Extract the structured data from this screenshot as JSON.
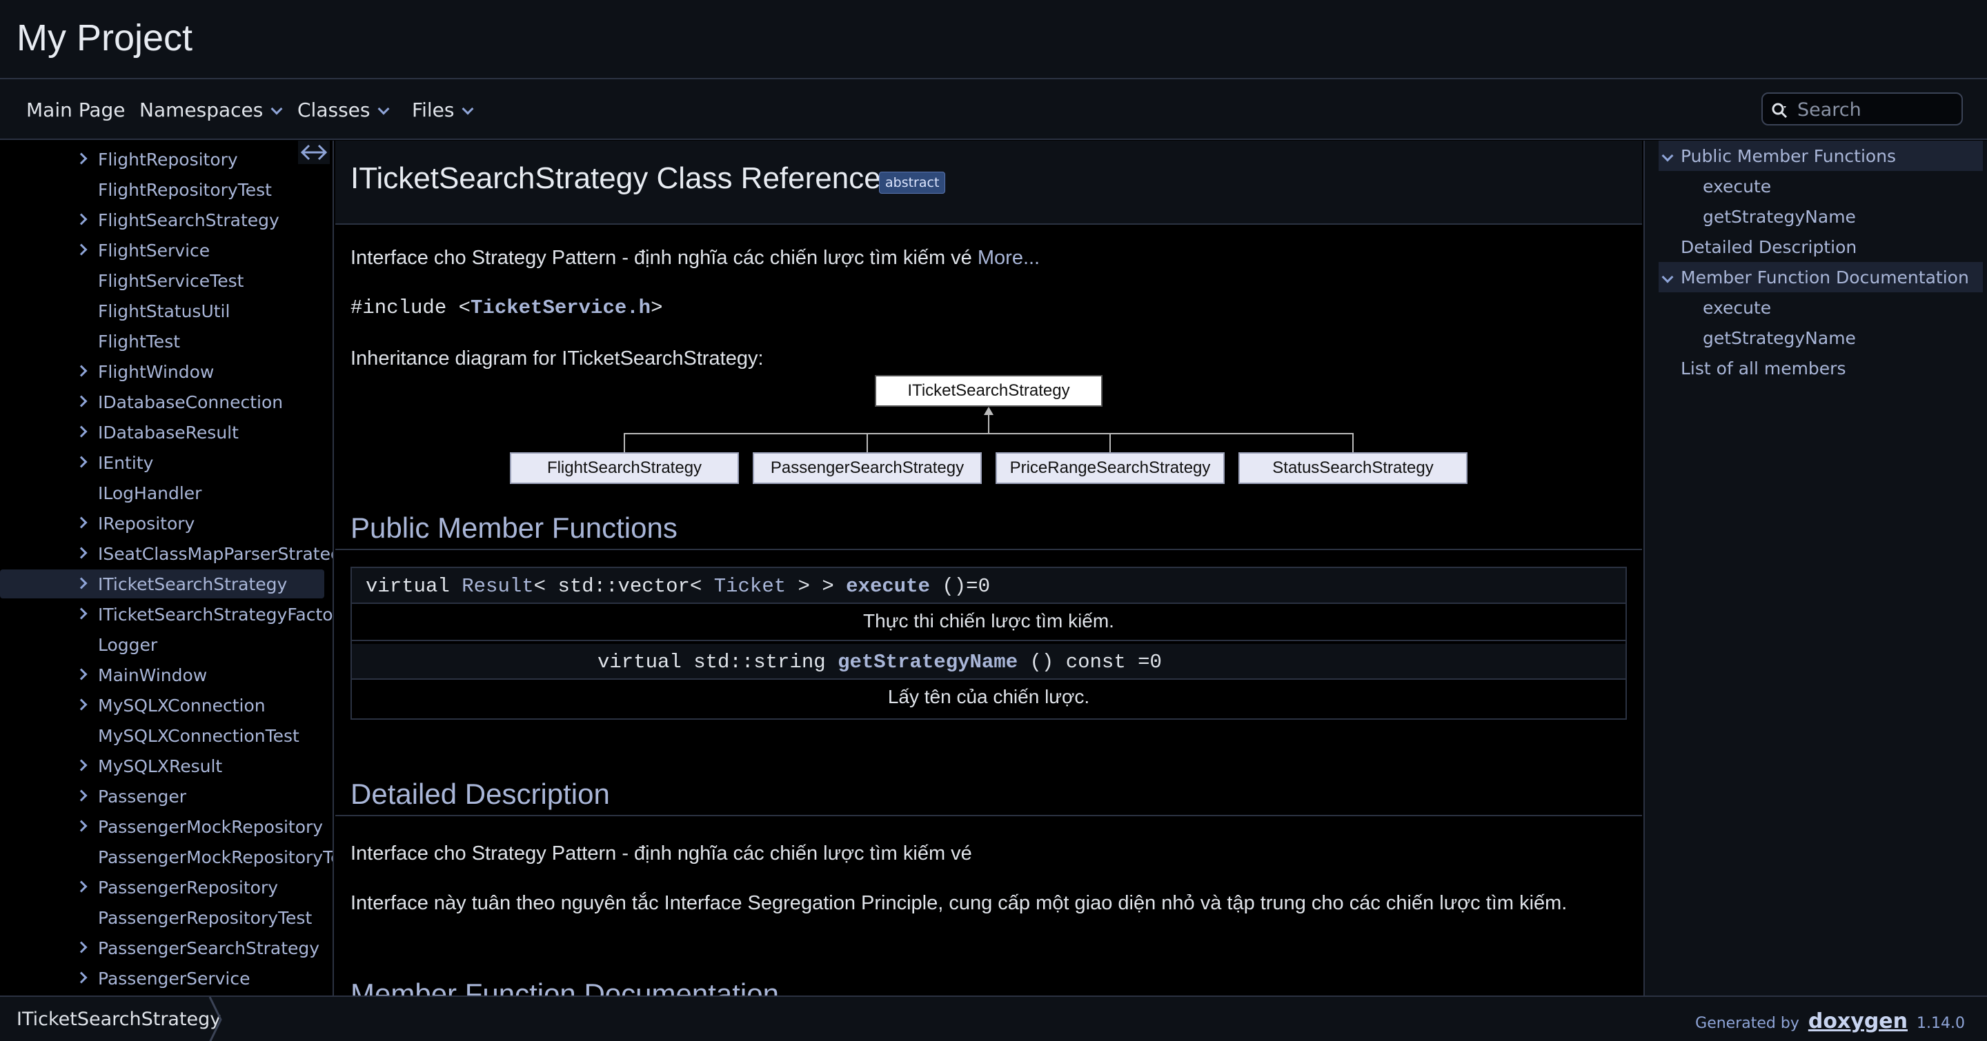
{
  "project": {
    "name": "My Project"
  },
  "nav": {
    "main_page": "Main Page",
    "namespaces": "Namespaces",
    "classes": "Classes",
    "files": "Files",
    "search_placeholder": "Search"
  },
  "tree": {
    "items": [
      {
        "label": "FlightRepository",
        "expandable": true
      },
      {
        "label": "FlightRepositoryTest",
        "expandable": false
      },
      {
        "label": "FlightSearchStrategy",
        "expandable": true
      },
      {
        "label": "FlightService",
        "expandable": true
      },
      {
        "label": "FlightServiceTest",
        "expandable": false
      },
      {
        "label": "FlightStatusUtil",
        "expandable": false
      },
      {
        "label": "FlightTest",
        "expandable": false
      },
      {
        "label": "FlightWindow",
        "expandable": true
      },
      {
        "label": "IDatabaseConnection",
        "expandable": true
      },
      {
        "label": "IDatabaseResult",
        "expandable": true
      },
      {
        "label": "IEntity",
        "expandable": true
      },
      {
        "label": "ILogHandler",
        "expandable": false
      },
      {
        "label": "IRepository",
        "expandable": true
      },
      {
        "label": "ISeatClassMapParserStrategy",
        "expandable": true
      },
      {
        "label": "ITicketSearchStrategy",
        "expandable": true,
        "selected": true
      },
      {
        "label": "ITicketSearchStrategyFactory",
        "expandable": true
      },
      {
        "label": "Logger",
        "expandable": false
      },
      {
        "label": "MainWindow",
        "expandable": true
      },
      {
        "label": "MySQLXConnection",
        "expandable": true
      },
      {
        "label": "MySQLXConnectionTest",
        "expandable": false
      },
      {
        "label": "MySQLXResult",
        "expandable": true
      },
      {
        "label": "Passenger",
        "expandable": true
      },
      {
        "label": "PassengerMockRepository",
        "expandable": true
      },
      {
        "label": "PassengerMockRepositoryTest",
        "expandable": false
      },
      {
        "label": "PassengerRepository",
        "expandable": true
      },
      {
        "label": "PassengerRepositoryTest",
        "expandable": false
      },
      {
        "label": "PassengerSearchStrategy",
        "expandable": true
      },
      {
        "label": "PassengerService",
        "expandable": true
      }
    ]
  },
  "page": {
    "title": "ITicketSearchStrategy Class Reference",
    "badge": "abstract",
    "brief": "Interface cho Strategy Pattern - định nghĩa các chiến lược tìm kiếm vé",
    "more": "More...",
    "include_prefix": "#include <",
    "include_file": "TicketService.h",
    "include_suffix": ">",
    "inheritance_label": "Inheritance diagram for ITicketSearchStrategy:",
    "diagram": {
      "base": "ITicketSearchStrategy",
      "children": [
        "FlightSearchStrategy",
        "PassengerSearchStrategy",
        "PriceRangeSearchStrategy",
        "StatusSearchStrategy"
      ]
    },
    "public_member_functions_title": "Public Member Functions",
    "members": [
      {
        "prefix": "virtual ",
        "type_link": "Result",
        "type_mid": "< std::vector< ",
        "type_link2": "Ticket",
        "type_end": " > > ",
        "name": "execute",
        "suffix": " ()=0",
        "desc": "Thực thi chiến lược tìm kiếm."
      },
      {
        "prefix": "virtual std::string ",
        "name": "getStrategyName",
        "suffix": " () const =0",
        "desc": "Lấy tên của chiến lược."
      }
    ],
    "detailed_title": "Detailed Description",
    "detailed_brief": "Interface cho Strategy Pattern - định nghĩa các chiến lược tìm kiếm vé",
    "detailed_body": "Interface này tuân theo nguyên tắc Interface Segregation Principle, cung cấp một giao diện nhỏ và tập trung cho các chiến lược tìm kiếm.",
    "member_doc_title": "Member Function Documentation"
  },
  "toc": {
    "public_member_functions": "Public Member Functions",
    "execute": "execute",
    "get_strategy_name": "getStrategyName",
    "detailed_description": "Detailed Description",
    "member_function_documentation": "Member Function Documentation",
    "execute2": "execute",
    "get_strategy_name2": "getStrategyName",
    "list_all_members": "List of all members"
  },
  "footer": {
    "breadcrumb": "ITicketSearchStrategy",
    "generated_by": "Generated by",
    "logo": "doxygen",
    "version": "1.14.0"
  },
  "colors": {
    "background": "#000000",
    "panel": "#0d1117",
    "link": "#a9b6d8",
    "text": "#e0e4ea",
    "border": "#2b3242",
    "selected": "#1c2333"
  }
}
